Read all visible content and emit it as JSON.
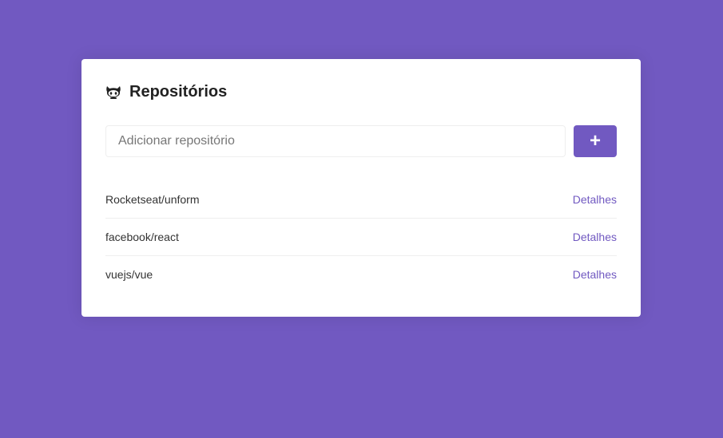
{
  "colors": {
    "background": "#7159c1",
    "accent": "#7159c1",
    "card": "#ffffff"
  },
  "header": {
    "icon": "github-icon",
    "title": "Repositórios"
  },
  "form": {
    "placeholder": "Adicionar repositório",
    "value": "",
    "add_button_icon": "plus-icon",
    "add_button_label": "+"
  },
  "repositories": [
    {
      "name": "Rocketseat/unform",
      "link_label": "Detalhes"
    },
    {
      "name": "facebook/react",
      "link_label": "Detalhes"
    },
    {
      "name": "vuejs/vue",
      "link_label": "Detalhes"
    }
  ]
}
